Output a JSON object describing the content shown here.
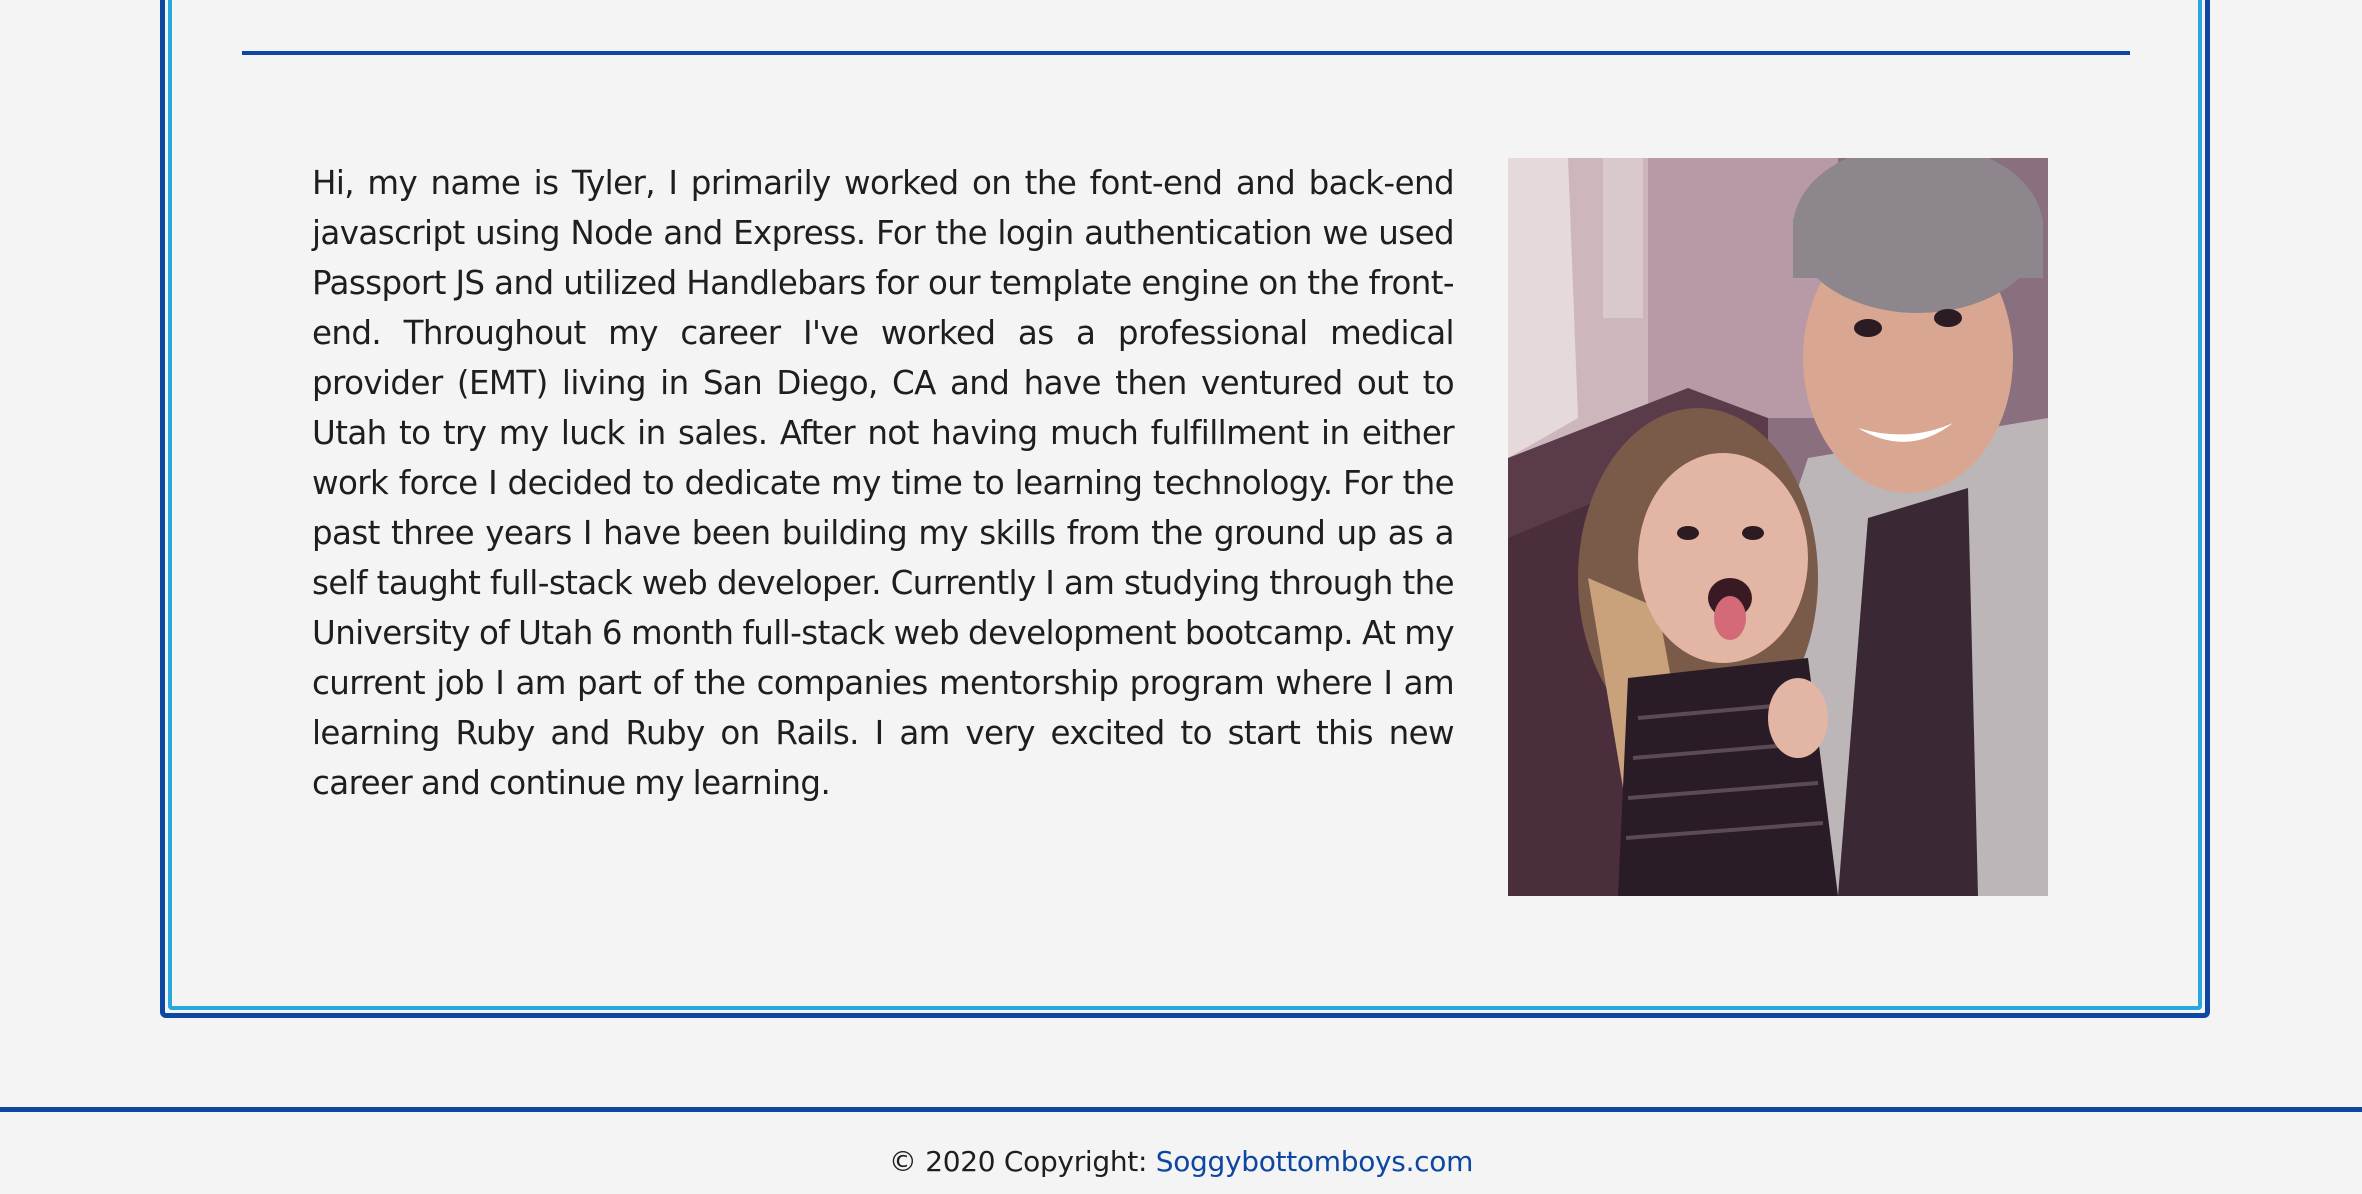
{
  "about": {
    "bio": "Hi, my name is Tyler, I primarily worked on the font-end and back-end javascript using Node and Express. For the login authentication we used Passport JS and utilized Handlebars for our template engine on the front-end. Throughout my career I've worked as a professional medical provider (EMT) living in San Diego, CA and have then ventured out to Utah to try my luck in sales. After not having much fulfillment in either work force I decided to dedicate my time to learning technology. For the past three years I have been building my skills from the ground up as a self taught full-stack web developer. Currently I am studying through the University of Utah 6 month full-stack web development bootcamp. At my current job I am part of the companies mentorship program where I am learning Ruby and Ruby on Rails. I am very excited to start this new career and continue my learning.",
    "photo_icon": "profile-photo"
  },
  "footer": {
    "copyright": "© 2020 Copyright:",
    "link_text": "Soggybottomboys.com"
  },
  "colors": {
    "accent": "#0d47a1",
    "accent_light": "#29a8e0",
    "background": "#f4f4f4",
    "text": "#1e1e1e"
  }
}
